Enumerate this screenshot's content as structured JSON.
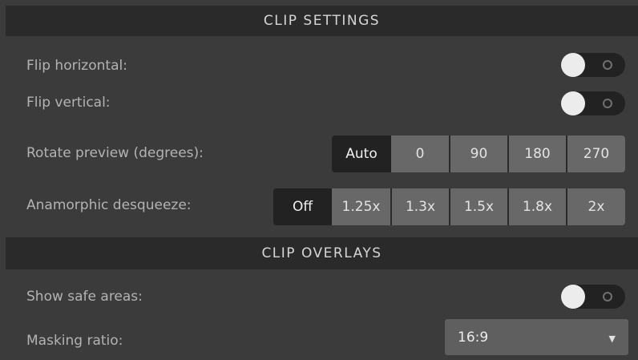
{
  "clip_settings": {
    "header": "CLIP SETTINGS",
    "flip_horizontal": {
      "label": "Flip horizontal:",
      "enabled": false
    },
    "flip_vertical": {
      "label": "Flip vertical:",
      "enabled": false
    },
    "rotate_preview": {
      "label": "Rotate preview (degrees):",
      "options": [
        "Auto",
        "0",
        "90",
        "180",
        "270"
      ],
      "selected": "Auto"
    },
    "anamorphic_desqueeze": {
      "label": "Anamorphic desqueeze:",
      "options": [
        "Off",
        "1.25x",
        "1.3x",
        "1.5x",
        "1.8x",
        "2x"
      ],
      "selected": "Off"
    }
  },
  "clip_overlays": {
    "header": "CLIP OVERLAYS",
    "show_safe_areas": {
      "label": "Show safe areas:",
      "enabled": false
    },
    "masking_ratio": {
      "label": "Masking ratio:",
      "value": "16:9",
      "caret_icon": "chevron-down-icon"
    }
  },
  "colors": {
    "background": "#3b3b3b",
    "header_background": "#2a2a2a",
    "segment_selected": "#222222",
    "segment_unselected": "#686868",
    "toggle_track": "#222222",
    "toggle_knob": "#ececec"
  }
}
